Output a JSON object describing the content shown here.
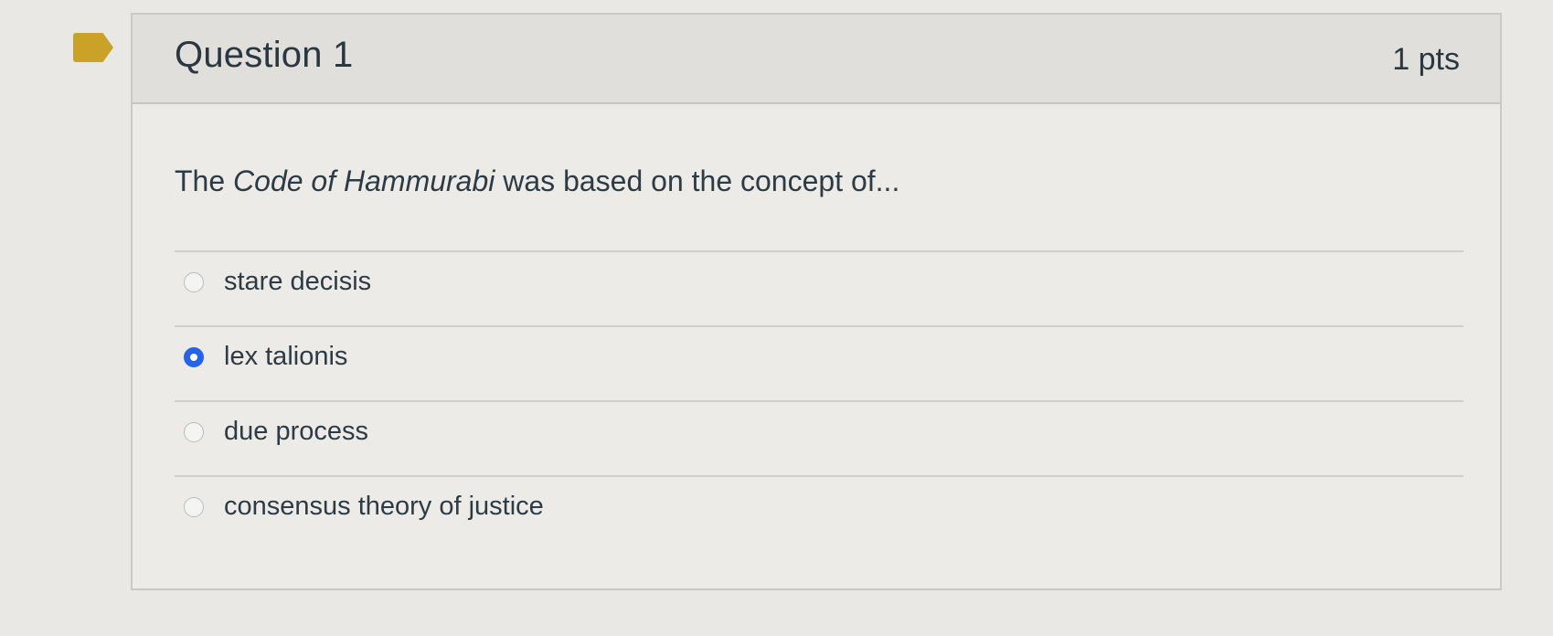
{
  "question": {
    "title": "Question 1",
    "points": "1 pts",
    "text_prefix": "The ",
    "text_emphasis": "Code of Hammurabi",
    "text_suffix": " was based on the concept of..."
  },
  "answers": [
    {
      "label": "stare decisis",
      "selected": false
    },
    {
      "label": "lex talionis",
      "selected": true
    },
    {
      "label": "due process",
      "selected": false
    },
    {
      "label": "consensus theory of justice",
      "selected": false
    }
  ],
  "colors": {
    "accent": "#2563eb",
    "bookmark": "#c9a227"
  },
  "icons": {
    "bookmark": "bookmark-flag-icon"
  }
}
